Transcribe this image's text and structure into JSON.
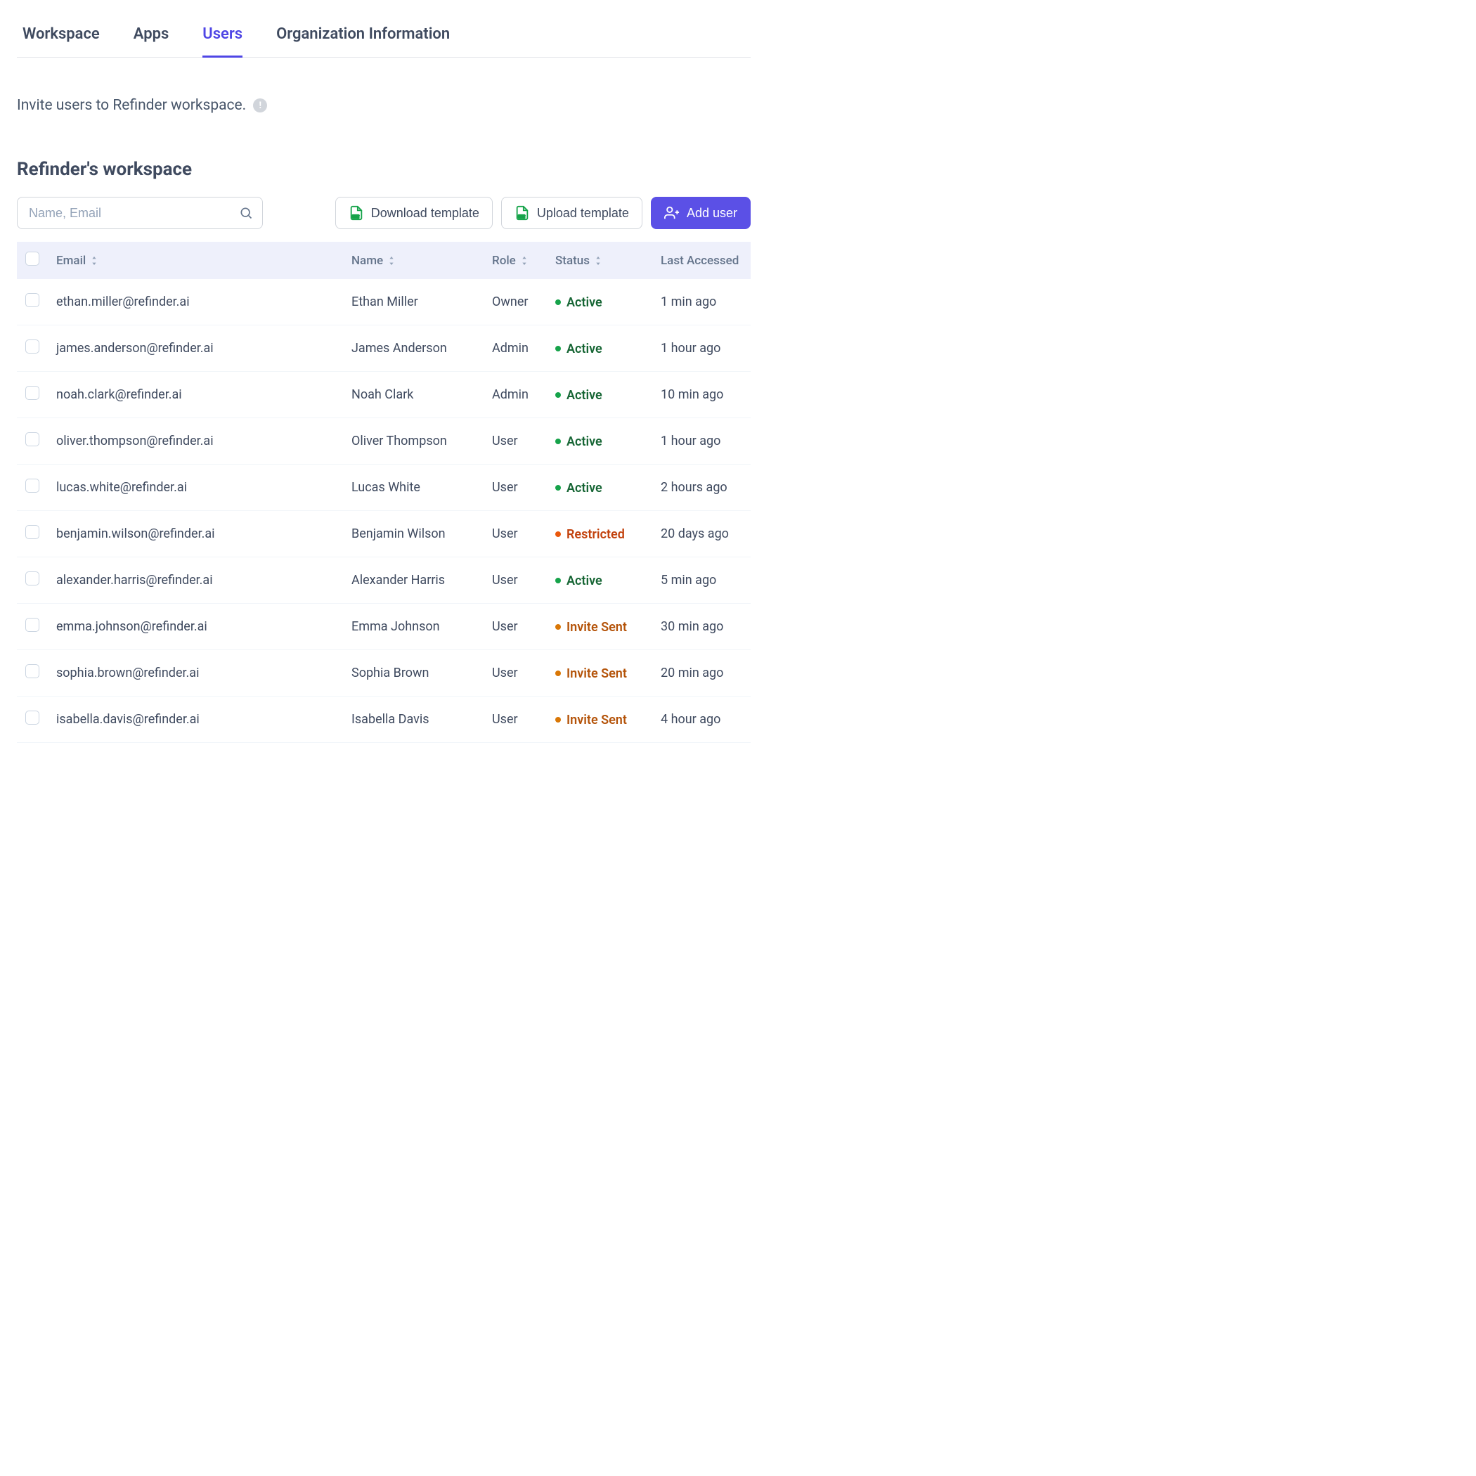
{
  "tabs": [
    {
      "label": "Workspace",
      "active": false
    },
    {
      "label": "Apps",
      "active": false
    },
    {
      "label": "Users",
      "active": true
    },
    {
      "label": "Organization Information",
      "active": false
    }
  ],
  "invite_text": "Invite users to Refinder workspace.",
  "workspace_heading": "Refinder's workspace",
  "search": {
    "placeholder": "Name, Email"
  },
  "toolbar": {
    "download_label": "Download template",
    "upload_label": "Upload template",
    "add_user_label": "Add user"
  },
  "columns": {
    "email": "Email",
    "name": "Name",
    "role": "Role",
    "status": "Status",
    "last": "Last Accessed"
  },
  "status_labels": {
    "active": "Active",
    "restricted": "Restricted",
    "invite": "Invite Sent"
  },
  "colors": {
    "accent": "#5b50e6",
    "status_active": "#166534",
    "status_restricted": "#c2410c",
    "status_invite": "#b45309"
  },
  "rows": [
    {
      "email": "ethan.miller@refinder.ai",
      "name": "Ethan Miller",
      "role": "Owner",
      "status": "active",
      "last": "1 min ago"
    },
    {
      "email": "james.anderson@refinder.ai",
      "name": "James Anderson",
      "role": "Admin",
      "status": "active",
      "last": "1 hour ago"
    },
    {
      "email": "noah.clark@refinder.ai",
      "name": "Noah Clark",
      "role": "Admin",
      "status": "active",
      "last": "10 min ago"
    },
    {
      "email": "oliver.thompson@refinder.ai",
      "name": "Oliver Thompson",
      "role": "User",
      "status": "active",
      "last": "1 hour ago"
    },
    {
      "email": "lucas.white@refinder.ai",
      "name": "Lucas White",
      "role": "User",
      "status": "active",
      "last": "2 hours ago"
    },
    {
      "email": "benjamin.wilson@refinder.ai",
      "name": "Benjamin Wilson",
      "role": "User",
      "status": "restricted",
      "last": "20 days ago"
    },
    {
      "email": "alexander.harris@refinder.ai",
      "name": "Alexander Harris",
      "role": "User",
      "status": "active",
      "last": "5 min ago"
    },
    {
      "email": "emma.johnson@refinder.ai",
      "name": "Emma Johnson",
      "role": "User",
      "status": "invite",
      "last": "30 min ago"
    },
    {
      "email": "sophia.brown@refinder.ai",
      "name": "Sophia Brown",
      "role": "User",
      "status": "invite",
      "last": "20 min ago"
    },
    {
      "email": "isabella.davis@refinder.ai",
      "name": "Isabella Davis",
      "role": "User",
      "status": "invite",
      "last": "4 hour ago"
    }
  ]
}
